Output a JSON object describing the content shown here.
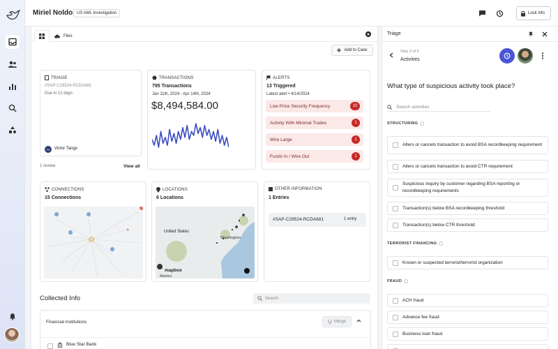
{
  "header": {
    "user_name": "Miriel Noldorin",
    "case_tag": "US AML Investigation",
    "lock_label": "Lock info"
  },
  "tabs": [
    {
      "label": ""
    },
    {
      "label": "Files"
    }
  ],
  "toolbar": {
    "add_to_case": "Add to Case"
  },
  "triage_card": {
    "title": "TRIAGE",
    "case_id": "#SAP-C29524-RCDA681",
    "due": "Due in 12 days",
    "assignee": "Victor Tango",
    "assignee_initials": "TV",
    "reviews": "1 review",
    "view_all": "View all"
  },
  "transactions_card": {
    "title": "TRANSACTIONS",
    "count": "795 Transactions",
    "date_range": "Jan 11th, 2024 - Apr 14th, 2024",
    "amount": "$8,494,584.00"
  },
  "alerts_card": {
    "title": "ALERTS",
    "triggered": "13 Triggered",
    "latest": "Latest alert • 4/14/2024",
    "items": [
      {
        "label": "Low Price Security Frequency",
        "count": "10"
      },
      {
        "label": "Activity With Minimal Trades",
        "count": "1"
      },
      {
        "label": "Wire Large",
        "count": "1"
      },
      {
        "label": "Funds In / Wire Out",
        "count": "1"
      }
    ]
  },
  "connections_card": {
    "title": "CONNECTIONS",
    "count": "15 Connections"
  },
  "locations_card": {
    "title": "LOCATIONS",
    "count": "6 Locations",
    "map_labels": {
      "country": "United States",
      "city": "Washington",
      "attribution": "mapbox",
      "sea": "Mexico"
    }
  },
  "other_card": {
    "title": "OTHER INFORMATION",
    "count": "1 Entries",
    "entry_id": "#SAP-C29524-RCDA681",
    "entry_count": "1 entry"
  },
  "collected": {
    "title": "Collected Info",
    "search_placeholder": "Search",
    "section": "Financial institutions",
    "merge": "Merge",
    "first_row": "Blue Star Bank"
  },
  "triage_panel": {
    "title": "Triage",
    "step": "Step 2 of 5",
    "step_name": "Activities",
    "question": "What type of suspicious activity took place?",
    "search_placeholder": "Search activities",
    "sections": [
      {
        "name": "STRUCTURING",
        "options": [
          "Alters or cancels transaction to avoid BSA recordkeeping requirement",
          "Alters or cancels transaction to avoid CTR requirement",
          "Suspicious inquiry by customer regarding BSA reporting or recordkeeping requirements",
          "Transaction(s) below BSA recordkeeping threshold",
          "Transaction(s) below CTR threshold"
        ]
      },
      {
        "name": "TERRORIST FINANCING",
        "options": [
          "Known or suspected terrorist/terrorist organization"
        ]
      },
      {
        "name": "FRAUD",
        "options": [
          "ACH fraud",
          "Advance fee fraud",
          "Business loan fraud"
        ]
      }
    ]
  },
  "colors": {
    "accent": "#4a56d6",
    "alert_bg": "#fbe9e7",
    "alert_badge": "#c62828",
    "sparkline": "#3b4cc0"
  },
  "sparkline": [
    5,
    2,
    7,
    1,
    9,
    3,
    6,
    2,
    10,
    4,
    8,
    3,
    9,
    5,
    11,
    6,
    12,
    5,
    9,
    7,
    13,
    8,
    11,
    6,
    12,
    7,
    10,
    5,
    9,
    4,
    10,
    3,
    7,
    2,
    6,
    1
  ]
}
